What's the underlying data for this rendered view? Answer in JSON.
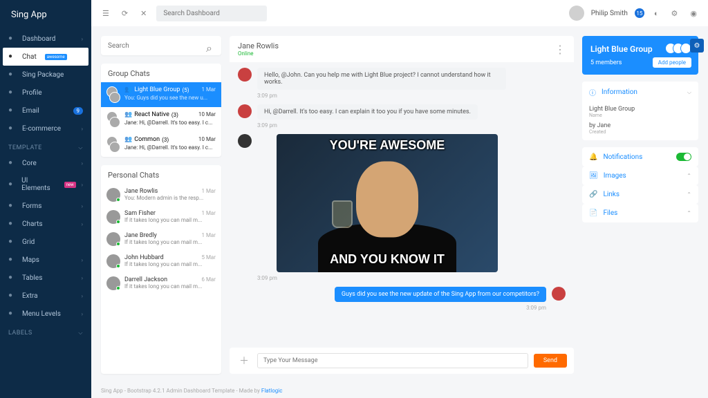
{
  "brand": "Sing App",
  "nav": [
    {
      "label": "Dashboard",
      "icon": "home",
      "chev": true
    },
    {
      "label": "Chat",
      "icon": "chat",
      "active": true,
      "tag": "awesome"
    },
    {
      "label": "Sing Package",
      "icon": "package"
    },
    {
      "label": "Profile",
      "icon": "user"
    },
    {
      "label": "Email",
      "icon": "email",
      "badge": "9"
    },
    {
      "label": "E-commerce",
      "icon": "cart",
      "chev": true
    }
  ],
  "nav_section_template": "TEMPLATE",
  "nav2": [
    {
      "label": "Core",
      "icon": "core",
      "chev": true
    },
    {
      "label": "UI Elements",
      "icon": "ui",
      "tag": "new",
      "chev": true
    },
    {
      "label": "Forms",
      "icon": "forms",
      "chev": true
    },
    {
      "label": "Charts",
      "icon": "charts",
      "chev": true
    },
    {
      "label": "Grid",
      "icon": "grid"
    },
    {
      "label": "Maps",
      "icon": "maps",
      "chev": true
    },
    {
      "label": "Tables",
      "icon": "tables",
      "chev": true
    },
    {
      "label": "Extra",
      "icon": "extra",
      "chev": true
    },
    {
      "label": "Menu Levels",
      "icon": "levels",
      "chev": true
    }
  ],
  "nav_section_labels": "LABELS",
  "topbar": {
    "search_placeholder": "Search Dashboard",
    "user": "Philip Smith",
    "badge": "15"
  },
  "col_search_placeholder": "Search",
  "group_chats_label": "Group Chats",
  "group_chats": [
    {
      "name": "Light Blue Group",
      "count": "(5)",
      "date": "1 Mar",
      "preview": "You:  Guys did you see the new u...",
      "sel": true
    },
    {
      "name": "React Native",
      "count": "(3)",
      "date": "10 Mar",
      "preview": "Jane:  Hi, @Darrell. It's too easy. I c..."
    },
    {
      "name": "Common",
      "count": "(3)",
      "date": "10 Mar",
      "preview": "Jane:  Hi, @Darrell. It's too easy. I c..."
    }
  ],
  "personal_chats_label": "Personal Chats",
  "personal_chats": [
    {
      "name": "Jane Rowlis",
      "date": "1 Mar",
      "preview": "You:  Modern admin is the resp..."
    },
    {
      "name": "Sam Fisher",
      "date": "1 Mar",
      "preview": "If it takes long you can mail m..."
    },
    {
      "name": "Jane Bredly",
      "date": "1 Mar",
      "preview": "If it takes long you can mail m..."
    },
    {
      "name": "John Hubbard",
      "date": "5 Mar",
      "preview": "If it takes long you can mail m..."
    },
    {
      "name": "Darrell Jackson",
      "date": "6 Mar",
      "preview": "If it takes long you can mail m..."
    }
  ],
  "chat": {
    "title": "Jane Rowlis",
    "status": "Online",
    "messages": [
      {
        "side": "l",
        "text": "Hello, @John. Can you help me with Light Blue project? I cannot understand how it works.",
        "time": "3:09 pm"
      },
      {
        "side": "l",
        "text": "Hi, @Darrell. It's too easy. I can explain it too you if you have some minutes.",
        "time": "3:09 pm"
      },
      {
        "side": "img",
        "top": "YOU'RE AWESOME",
        "bottom": "AND YOU KNOW IT",
        "time": "3:09 pm"
      },
      {
        "side": "r",
        "text": "Guys did you see the new update of the Sing App from our competitors?",
        "time": "3:09 pm"
      }
    ],
    "compose_placeholder": "Type Your Message",
    "send_label": "Send"
  },
  "info": {
    "group_name": "Light Blue Group",
    "members": "5 members",
    "add_label": "Add people",
    "information_label": "Information",
    "info_name": "Light Blue Group",
    "info_name_sub": "Name",
    "info_creator": "by Jane",
    "info_creator_sub": "Created",
    "rows": [
      {
        "label": "Notifications",
        "kind": "toggle"
      },
      {
        "label": "Images",
        "kind": "chev"
      },
      {
        "label": "Links",
        "kind": "chev"
      },
      {
        "label": "Files",
        "kind": "chev"
      }
    ]
  },
  "footer": {
    "text": "Sing App - Bootstrap 4.2.1 Admin Dashboard Template - Made by ",
    "link": "Flatlogic"
  }
}
